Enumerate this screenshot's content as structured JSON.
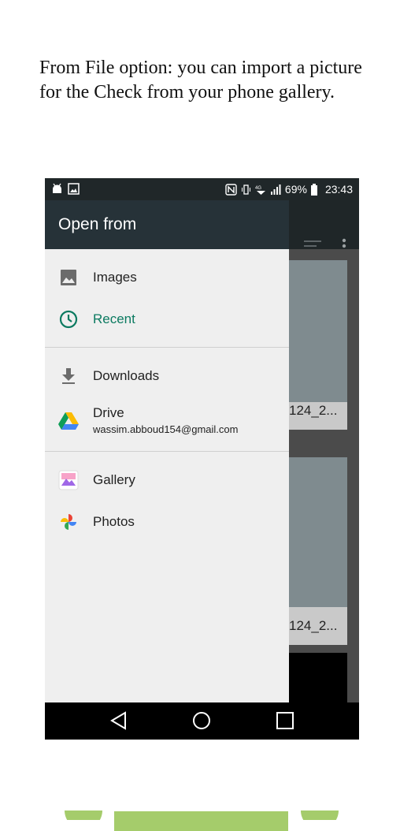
{
  "intro_text": "From File option: you can import a picture for the Check from your phone gallery.",
  "status_bar": {
    "battery": "69%",
    "time": "23:43"
  },
  "drawer": {
    "title": "Open from",
    "items": [
      {
        "label": "Images",
        "icon": "image-icon"
      },
      {
        "label": "Recent",
        "icon": "clock-icon",
        "color": "#0b7a60"
      },
      {
        "label": "Downloads",
        "icon": "download-icon"
      },
      {
        "label": "Drive",
        "sublabel": "wassim.abboud154@gmail.com",
        "icon": "google-drive-icon"
      },
      {
        "label": "Gallery",
        "icon": "gallery-icon"
      },
      {
        "label": "Photos",
        "icon": "google-photos-icon"
      }
    ]
  },
  "background_files": [
    {
      "caption": "124_2..."
    },
    {
      "caption": "124_2..."
    }
  ],
  "colors": {
    "drawer_header": "#263238",
    "accent_recent": "#0b7a60",
    "deco_green": "#a5cc6b"
  }
}
